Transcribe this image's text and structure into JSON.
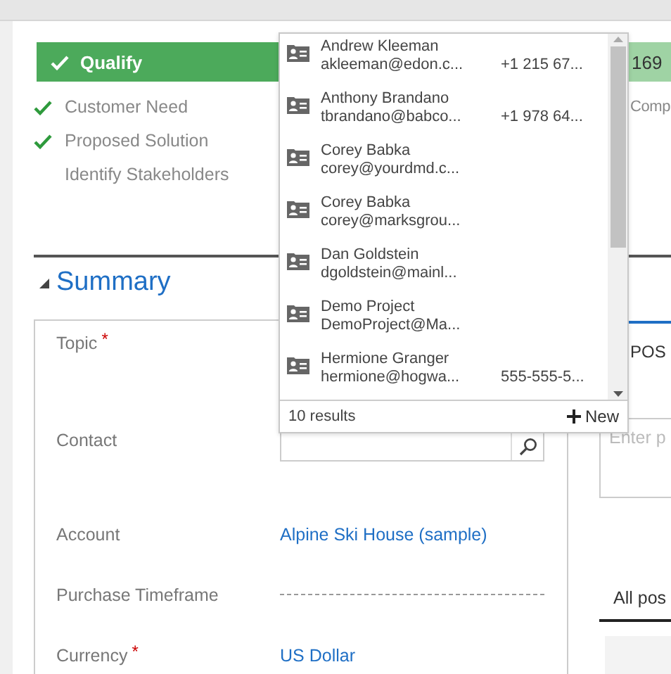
{
  "process": {
    "stages": [
      {
        "label": "Qualify",
        "selected": true
      },
      {
        "label": "169",
        "selected": false
      }
    ],
    "steps": [
      {
        "label": "Customer Need",
        "checked": true
      },
      {
        "label": "Proposed Solution",
        "checked": true
      },
      {
        "label": "Identify Stakeholders",
        "checked": false
      }
    ],
    "next_steps": [
      "Comp"
    ]
  },
  "summary": {
    "title": "Summary",
    "expanded": true,
    "required_symbol": "*",
    "fields": [
      {
        "label": "Topic",
        "required": true,
        "kind": "text"
      },
      {
        "label": "Contact",
        "required": false,
        "kind": "lookup"
      },
      {
        "label": "Account",
        "required": false,
        "kind": "link",
        "value": "Alpine Ski House (sample)"
      },
      {
        "label": "Purchase Timeframe",
        "required": false,
        "kind": "empty"
      },
      {
        "label": "Currency",
        "required": true,
        "kind": "link",
        "value": "US Dollar"
      }
    ]
  },
  "lookup": {
    "results": [
      {
        "name": "Andrew Kleeman",
        "email": "akleeman@edon.c...",
        "phone": "+1 215 67..."
      },
      {
        "name": "Anthony Brandano",
        "email": "tbrandano@babco...",
        "phone": "+1 978 64..."
      },
      {
        "name": "Corey Babka",
        "email": "corey@yourdmd.c..."
      },
      {
        "name": "Corey Babka",
        "email": "corey@marksgrou..."
      },
      {
        "name": "Dan Goldstein",
        "email": "dgoldstein@mainl..."
      },
      {
        "name": "Demo Project",
        "email": "DemoProject@Ma..."
      },
      {
        "name": "Hermione Granger",
        "email": "hermione@hogwa...",
        "phone": "555-555-5..."
      }
    ],
    "count": "10 results",
    "new_label": "New"
  },
  "posts": {
    "tab": "POS",
    "placeholder": "Enter p",
    "filter": "All pos"
  }
}
